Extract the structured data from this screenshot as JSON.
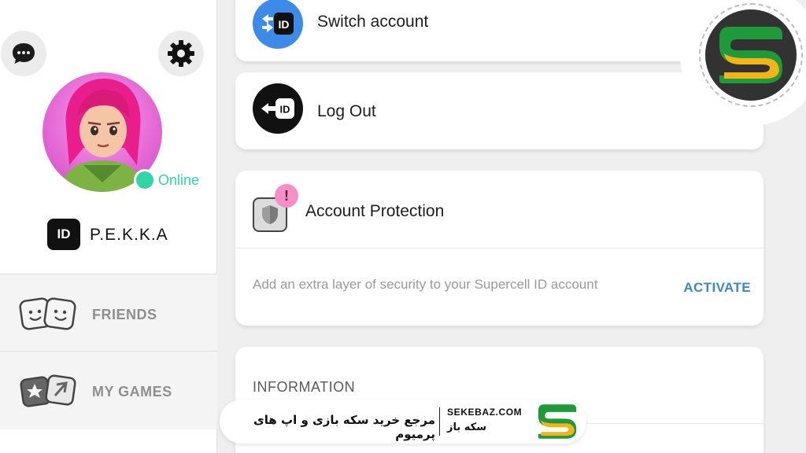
{
  "sidebar": {
    "status": "Online",
    "id_badge": "ID",
    "username": "P.E.K.K.A",
    "nav": [
      {
        "label": "FRIENDS",
        "icon": "friends-icon"
      },
      {
        "label": "MY GAMES",
        "icon": "games-icon"
      }
    ]
  },
  "cards": {
    "switch": {
      "title": "Switch account",
      "icon_text": "ID"
    },
    "logout": {
      "title": "Log Out",
      "icon_text": "ID"
    },
    "protection": {
      "title": "Account Protection",
      "alert": "!",
      "description": "Add an extra layer of security to your Supercell ID account",
      "action": "ACTIVATE"
    },
    "info": {
      "title": "INFORMATION"
    }
  },
  "banner": {
    "tagline": "مرجع خرید سکه بازی و اپ های پرمیوم",
    "domain": "SEKEBAZ.COM",
    "brand": "سکه باز"
  },
  "colors": {
    "accent_blue": "#3c86cf",
    "online_green": "#2fd6a6",
    "alert_pink": "#f58ec9",
    "logo_green": "#1f9a3a",
    "logo_yellow": "#f2b417"
  }
}
